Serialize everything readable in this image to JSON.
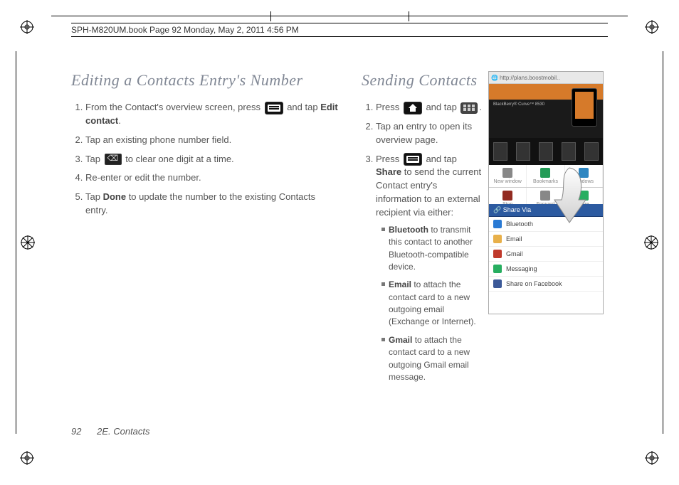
{
  "header": "SPH-M820UM.book  Page 92  Monday, May 2, 2011  4:56 PM",
  "left": {
    "title": "Editing a Contacts Entry's Number",
    "s1a": "From the Contact's overview screen, press ",
    "s1b": " and tap ",
    "s1c": "Edit contact",
    "s1d": ".",
    "s2": "Tap an existing phone number field.",
    "s3a": "Tap ",
    "s3b": " to clear one digit at a time.",
    "s4": "Re-enter or edit the number.",
    "s5a": "Tap ",
    "s5b": "Done",
    "s5c": " to update the number to the existing Contacts entry."
  },
  "right": {
    "title": "Sending Contacts",
    "s1a": "Press ",
    "s1b": " and tap ",
    "s1c": ".",
    "s2": "Tap an entry to open its overview page.",
    "s3a": "Press ",
    "s3b": " and tap ",
    "s3c": "Share",
    "s3d": " to send the current Contact entry's information to an external recipient via either:",
    "b1a": "Bluetooth",
    "b1b": " to transmit this contact to another Bluetooth-compatible device.",
    "b2a": "Email",
    "b2b": " to attach the contact card to a new outgoing email (Exchange or Internet).",
    "b3a": "Gmail",
    "b3b": " to attach the contact card to a new outgoing Gmail email message."
  },
  "shot": {
    "url": "http://plans.boostmobil..",
    "heroTitle": "BlackBerry® Curve™ 8530",
    "t1": "New window",
    "t2": "Bookmarks",
    "t3": "Windows",
    "t4": "Stop",
    "t5": "Forward",
    "t6": "More",
    "ohdr": "Share Via",
    "o1": "Bluetooth",
    "o2": "Email",
    "o3": "Gmail",
    "o4": "Messaging",
    "o5": "Share on Facebook"
  },
  "footer": {
    "page": "92",
    "section": "2E. Contacts"
  }
}
